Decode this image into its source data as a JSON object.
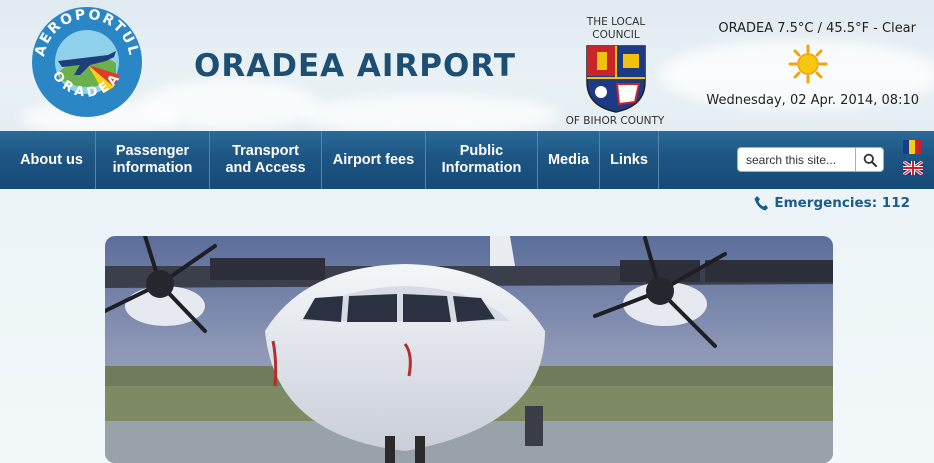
{
  "header": {
    "logo_ring_top": "AEROPORTUL",
    "logo_ring_bottom": "ORADEA",
    "title": "ORADEA AIRPORT",
    "council_top_line1": "THE LOCAL",
    "council_top_line2": "COUNCIL",
    "council_bottom": "OF BIHOR COUNTY",
    "weather": "ORADEA  7.5°C / 45.5°F - Clear",
    "weather_icon": "sun-icon",
    "datetime": "Wednesday, 02 Apr. 2014, 08:10"
  },
  "nav": {
    "items": [
      {
        "line1": "About us",
        "line2": ""
      },
      {
        "line1": "Passenger",
        "line2": "information"
      },
      {
        "line1": "Transport",
        "line2": "and Access"
      },
      {
        "line1": "Airport fees",
        "line2": ""
      },
      {
        "line1": "Public",
        "line2": "Information"
      },
      {
        "line1": "Media",
        "line2": ""
      },
      {
        "line1": "Links",
        "line2": ""
      }
    ],
    "search_placeholder": "search this site...",
    "search_icon": "magnifier-icon",
    "languages": [
      "romanian-flag-icon",
      "uk-flag-icon"
    ]
  },
  "emergency": {
    "icon": "phone-icon",
    "text": "Emergencies: 112"
  },
  "colors": {
    "nav_bg": "#1d5583",
    "title": "#1d4f74",
    "emergency": "#1a5c8c"
  }
}
